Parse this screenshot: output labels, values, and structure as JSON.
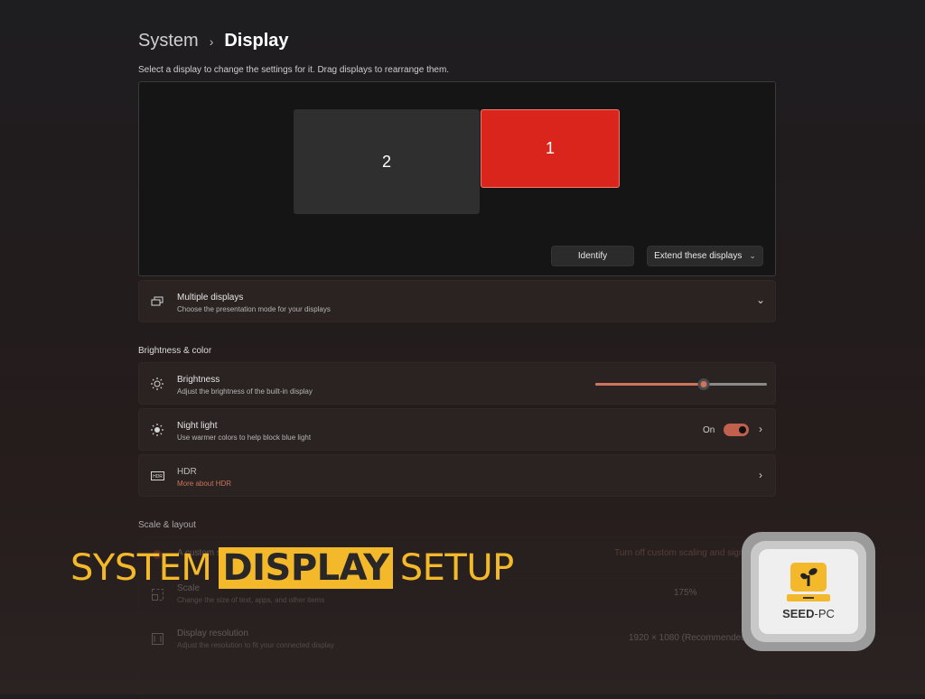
{
  "breadcrumb": {
    "parent": "System",
    "separator": "›",
    "current": "Display"
  },
  "subtitle": "Select a display to change the settings for it. Drag displays to rearrange them.",
  "arrangement": {
    "monitors": [
      {
        "label": "2",
        "selected": false
      },
      {
        "label": "1",
        "selected": true
      }
    ],
    "identify_label": "Identify",
    "mode_label": "Extend these displays"
  },
  "multiple_displays": {
    "title": "Multiple displays",
    "desc": "Choose the presentation mode for your displays"
  },
  "brightness_section": "Brightness & color",
  "brightness": {
    "title": "Brightness",
    "desc": "Adjust the brightness of the built-in display",
    "value": 0.63
  },
  "night_light": {
    "title": "Night light",
    "desc": "Use warmer colors to help block blue light",
    "state_label": "On",
    "on": true
  },
  "hdr": {
    "title": "HDR",
    "link": "More about HDR"
  },
  "scale_section": "Scale & layout",
  "custom_scale": {
    "title": "A custom scaling factor is set",
    "action": "Turn off custom scaling and sign out"
  },
  "scale": {
    "title": "Scale",
    "desc": "Change the size of text, apps, and other items",
    "value": "175%"
  },
  "resolution": {
    "title": "Display resolution",
    "desc": "Adjust the resolution to fit your connected display",
    "value": "1920 × 1080 (Recommended)"
  },
  "banner": {
    "pre": "SYSTEM",
    "highlight": "DISPLAY",
    "post": "SETUP"
  },
  "logo": {
    "brand_bold": "SEED",
    "brand_rest": "-PC"
  },
  "colors": {
    "accent": "#d0735d",
    "selected_monitor": "#d9251c",
    "banner": "#f4b92a",
    "link": "#c8745e"
  }
}
